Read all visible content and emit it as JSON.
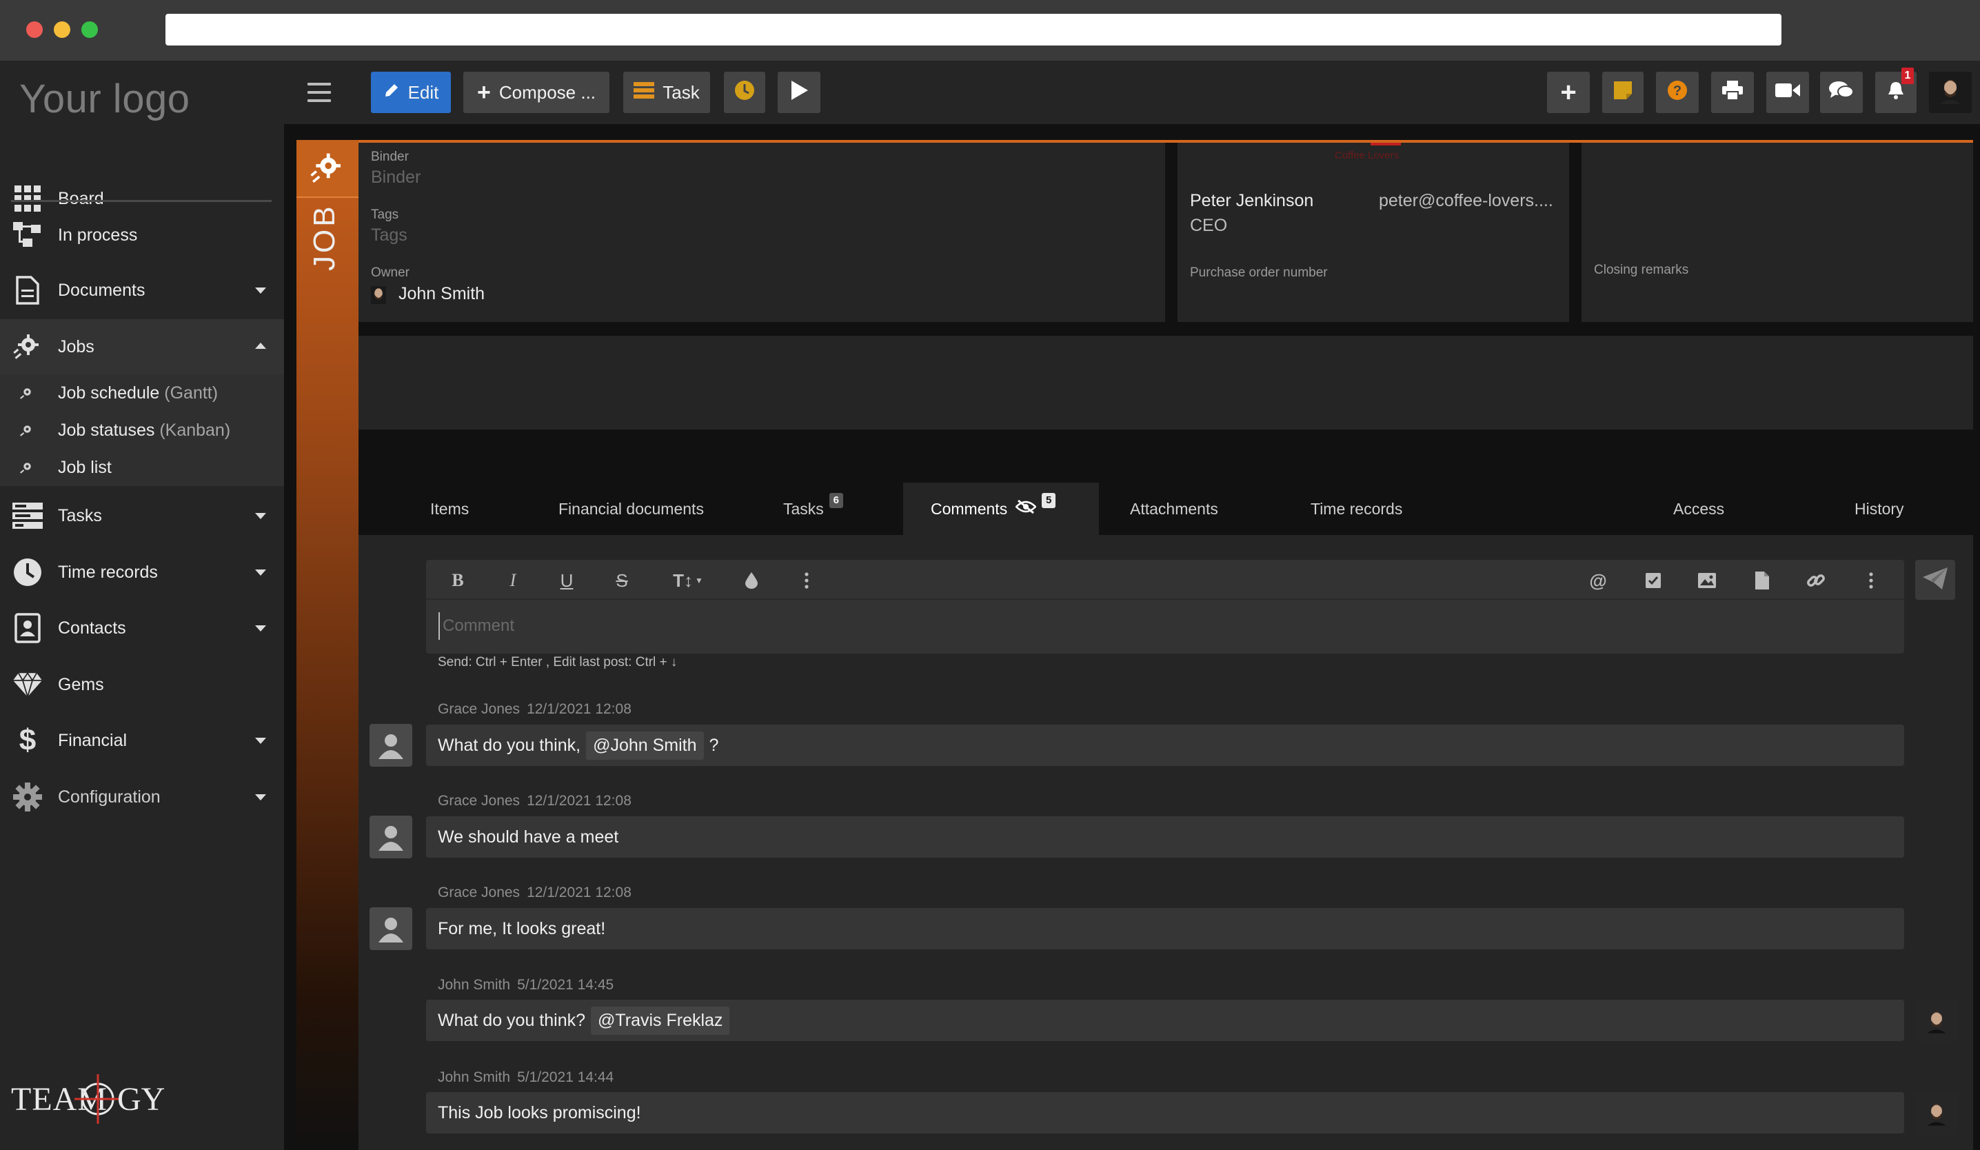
{
  "app": {
    "logo": "Your logo",
    "brand": "TEAMOGY"
  },
  "sidebar": {
    "items": [
      {
        "label": "Board",
        "icon": "grid-icon"
      },
      {
        "label": "In process",
        "icon": "process-icon"
      },
      {
        "label": "Documents",
        "icon": "document-icon"
      },
      {
        "label": "Jobs",
        "icon": "jobs-gear-icon"
      },
      {
        "label": "Tasks",
        "icon": "tasks-icon"
      },
      {
        "label": "Time records",
        "icon": "clock-icon"
      },
      {
        "label": "Contacts",
        "icon": "contacts-icon"
      },
      {
        "label": "Gems",
        "icon": "gem-icon"
      },
      {
        "label": "Financial",
        "icon": "dollar-icon"
      },
      {
        "label": "Configuration",
        "icon": "gear-icon"
      }
    ],
    "jobs_sub": [
      {
        "label": "Job schedule",
        "hint": "(Gantt)"
      },
      {
        "label": "Job statuses",
        "hint": "(Kanban)"
      },
      {
        "label": "Job list",
        "hint": ""
      }
    ]
  },
  "toolbar": {
    "edit_label": "Edit",
    "compose_label": "Compose ...",
    "task_label": "Task",
    "notification_count": "1",
    "colors": {
      "edit": "#2a6fc9",
      "timer": "#d4a018",
      "notes": "#d4a018",
      "help": "#e8870e"
    }
  },
  "job": {
    "strip_label": "JOB",
    "binder_label": "Binder",
    "binder_placeholder": "Binder",
    "tags_label": "Tags",
    "tags_placeholder": "Tags",
    "owner_label": "Owner",
    "owner_name": "John Smith",
    "company": "Coffee Lovers",
    "contact_name": "Peter Jenkinson",
    "contact_email": "peter@coffee-lovers....",
    "contact_role": "CEO",
    "po_label": "Purchase order number",
    "closing_label": "Closing remarks"
  },
  "tabs": [
    {
      "label": "Items",
      "badge": ""
    },
    {
      "label": "Financial documents",
      "badge": ""
    },
    {
      "label": "Tasks",
      "badge": "6"
    },
    {
      "label": "Comments",
      "badge": "5"
    },
    {
      "label": "Attachments",
      "badge": ""
    },
    {
      "label": "Time records",
      "badge": ""
    },
    {
      "label": "Access",
      "badge": ""
    },
    {
      "label": "History",
      "badge": ""
    }
  ],
  "editor": {
    "placeholder": "Comment",
    "hint": "Send: Ctrl + Enter , Edit last post: Ctrl + ↓"
  },
  "comments": [
    {
      "author": "Grace Jones",
      "datetime": "12/1/2021  12:08",
      "before": "What do you think,",
      "mention": "@John Smith",
      "after": "?"
    },
    {
      "author": "Grace Jones",
      "datetime": "12/1/2021  12:08",
      "text": "We should have a meet"
    },
    {
      "author": "Grace Jones",
      "datetime": "12/1/2021  12:08",
      "text": "For me, It looks great!"
    },
    {
      "author": "John Smith",
      "datetime": "5/1/2021  14:45",
      "before": "What do you think?",
      "mention": "@Travis Freklaz",
      "after": ""
    },
    {
      "author": "John Smith",
      "datetime": "5/1/2021  14:44",
      "text": "This Job looks promiscing!"
    }
  ]
}
